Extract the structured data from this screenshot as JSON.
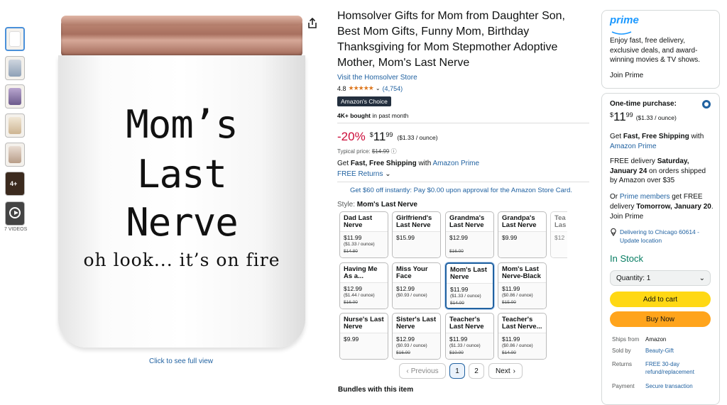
{
  "gallery": {
    "thumb_more": "4+",
    "videos_label": "7 VIDEOS",
    "jar_line1": "Mom’s",
    "jar_line2": "Last",
    "jar_line3": "Nerve",
    "jar_line4": "oh look... it’s on fire",
    "full_view": "Click to see full view"
  },
  "product": {
    "title": "Homsolver Gifts for Mom from Daughter Son, Best Mom Gifts, Funny Mom, Birthday Thanksgiving for Mom Stepmother Adoptive Mother, Mom's Last Nerve",
    "store": "Visit the Homsolver Store",
    "rating": "4.8",
    "stars": "★★★★★",
    "reviews": "(4,754)",
    "badge": "Amazon's Choice",
    "bought_bold": "4K+ bought",
    "bought_rest": " in past month",
    "discount": "-20%",
    "currency": "$",
    "price_whole": "11",
    "price_frac": "99",
    "unit_price": "($1.33 / ounce)",
    "typical_label": "Typical price: ",
    "typical_value": "$14.99",
    "ship_pre": "Get ",
    "ship_bold": "Fast, Free Shipping",
    "ship_mid": " with ",
    "ship_link": "Amazon Prime",
    "returns": "FREE Returns",
    "promo": "Get $60 off instantly: Pay $0.00 upon approval for the Amazon Store Card.",
    "style_label": "Style: ",
    "style_value": "Mom's Last Nerve",
    "bundles": "Bundles with this item"
  },
  "styles": [
    {
      "name": "Dad Last Nerve",
      "price": "$11.99",
      "unit": "($1.33 / ounce)",
      "old": "$14.80"
    },
    {
      "name": "Girlfriend's Last Nerve",
      "price": "$15.99",
      "unit": "",
      "old": ""
    },
    {
      "name": "Grandma's Last Nerve",
      "price": "$12.99",
      "unit": "",
      "old": "$16.00"
    },
    {
      "name": "Grandpa's Last Nerve",
      "price": "$9.99",
      "unit": "",
      "old": ""
    },
    {
      "name": "Tea Las",
      "price": "$12",
      "unit": "",
      "old": ""
    },
    {
      "name": "Having Me As a...",
      "price": "$12.99",
      "unit": "($1.44 / ounce)",
      "old": "$16.00"
    },
    {
      "name": "Miss Your Face",
      "price": "$12.99",
      "unit": "($0.93 / ounce)",
      "old": ""
    },
    {
      "name": "Mom's Last Nerve",
      "price": "$11.99",
      "unit": "($1.33 / ounce)",
      "old": "$14.00"
    },
    {
      "name": "Mom's Last Nerve-Black",
      "price": "$11.99",
      "unit": "($0.86 / ounce)",
      "old": "$15.00"
    },
    {
      "name": "Nurse's Last Nerve",
      "price": "$9.99",
      "unit": "",
      "old": ""
    },
    {
      "name": "Sister's Last Nerve",
      "price": "$12.99",
      "unit": "($0.93 / ounce)",
      "old": "$16.00"
    },
    {
      "name": "Teacher's Last Nerve",
      "price": "$11.99",
      "unit": "($1.33 / ounce)",
      "old": "$10.00"
    },
    {
      "name": "Teacher's Last Nerve...",
      "price": "$11.99",
      "unit": "($0.86 / ounce)",
      "old": "$14.00"
    }
  ],
  "pagination": {
    "prev": "Previous",
    "p1": "1",
    "p2": "2",
    "next": "Next"
  },
  "prime": {
    "logo": "prime",
    "text": "Enjoy fast, free delivery, exclusive deals, and award-winning movies & TV shows.",
    "join": "Join Prime"
  },
  "buybox": {
    "one_time": "One-time purchase:",
    "ship_a": "Get ",
    "ship_b": "Fast, Free Shipping",
    "ship_c": " with",
    "ship_link": "Amazon Prime",
    "del_a": "FREE delivery ",
    "del_b": "Saturday, January 24",
    "del_c": " on orders shipped by Amazon over $35",
    "or": "Or ",
    "prime_members": "Prime members",
    "fast_a": " get FREE delivery ",
    "fast_b": "Tomorrow, January 20",
    "fast_c": ".",
    "join": "Join Prime",
    "location": "Delivering to Chicago 60614 - Update location",
    "stock": "In Stock",
    "qty": "Quantity: 1",
    "add": "Add to cart",
    "buy": "Buy Now",
    "ships_from_l": "Ships from",
    "ships_from_v": "Amazon",
    "sold_by_l": "Sold by",
    "sold_by_v": "Beauty-Gift",
    "returns_l": "Returns",
    "returns_v": "FREE 30-day refund/replacement",
    "payment_l": "Payment",
    "payment_v": "Secure transaction"
  },
  "colors": {
    "link": "#2162a1",
    "deal": "#cc0c39",
    "stock": "#067d62",
    "add": "#ffd814",
    "buy": "#ffa41c"
  }
}
